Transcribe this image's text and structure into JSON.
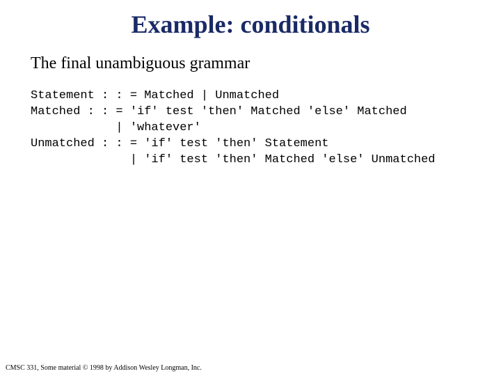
{
  "slide": {
    "title": "Example: conditionals",
    "subtitle": "The final unambiguous grammar",
    "code": "Statement : : = Matched | Unmatched\nMatched : : = 'if' test 'then' Matched 'else' Matched\n            | 'whatever'\nUnmatched : : = 'if' test 'then' Statement\n              | 'if' test 'then' Matched 'else' Unmatched",
    "footer": "CMSC 331, Some material © 1998 by Addison Wesley Longman, Inc."
  }
}
